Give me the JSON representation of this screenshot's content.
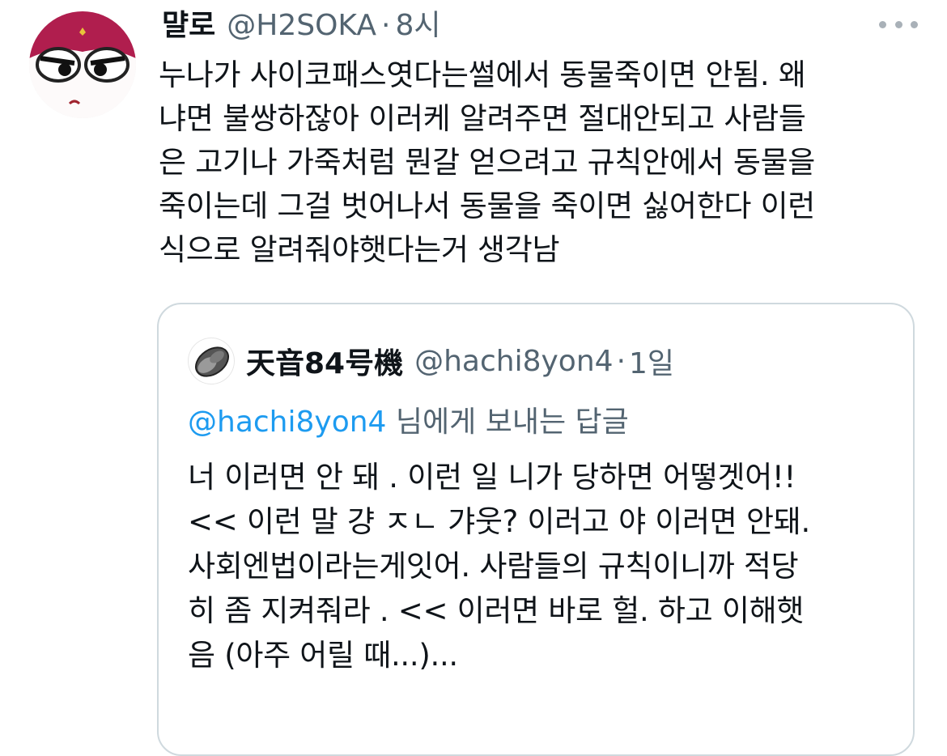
{
  "tweet": {
    "author_name": "먈로",
    "handle": "@H2SOKA",
    "separator": "·",
    "time": "8시",
    "avatar_icon": "character-face-avatar",
    "more_icon": "more-options-icon",
    "text": "누나가 사이코패스엿다는썰에서 동물죽이면 안됨. 왜\n냐면 불쌍하잖아 이러케 알려주면 절대안되고 사람들\n은 고기나 가죽처럼 뭔갈 얻으려고 규칙안에서 동물을\n죽이는데 그걸 벗어나서 동물을 죽이면 싫어한다 이런\n식으로 알려줘야햇다는거 생각남"
  },
  "quoted_tweet": {
    "author_name": "天音84号機",
    "handle": "@hachi8yon4",
    "separator": "·",
    "time": "1일",
    "avatar_icon": "gray-stone-avatar",
    "reply_mention": "@hachi8yon4",
    "reply_suffix": " 님에게 보내는 답글",
    "text": "너 이러면 안 돼 . 이런 일 니가 당하면 어떻겟어!!\n<< 이런 말 걍 ㅈㄴ 갸웃? 이러고 야 이러면 안돼.\n사회엔법이라는게잇어. 사람들의 규칙이니까 적당\n히 좀 지켜줘라 . << 이러면 바로 헐. 하고 이해햇\n음 (아주 어릴 때...)..."
  },
  "colors": {
    "text": "#0f1419",
    "secondary": "#536471",
    "link": "#1d9bf0",
    "border": "#cfd9de",
    "avatar_accent": "#b01e4e"
  }
}
